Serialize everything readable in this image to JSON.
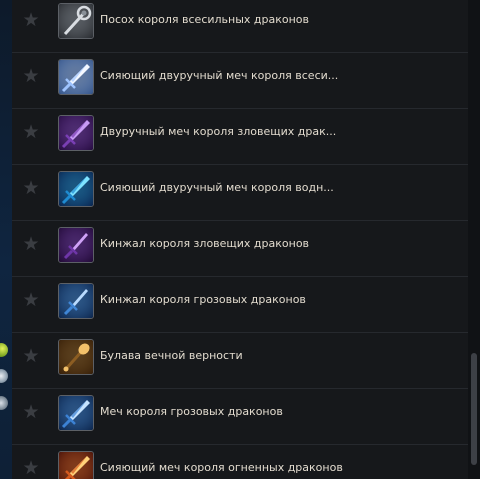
{
  "items": [
    {
      "name": "Посох короля всесильных драконов",
      "icon": "staff-icon",
      "colors": [
        "#d9dde2",
        "#8a9199",
        "#2c2f34"
      ]
    },
    {
      "name": "Сияющий двуручный меч короля всеси...",
      "icon": "sword-icon",
      "colors": [
        "#f4f8ff",
        "#9fc4ff",
        "#3a5a8f"
      ]
    },
    {
      "name": "Двуручный меч короля зловещих драк...",
      "icon": "sword-icon",
      "colors": [
        "#c89cf5",
        "#7a3fb4",
        "#2a0f45"
      ]
    },
    {
      "name": "Сияющий двуручный меч короля водн...",
      "icon": "sword-icon",
      "colors": [
        "#7fe3ff",
        "#1f8bd1",
        "#0b2a55"
      ]
    },
    {
      "name": "Кинжал короля зловещих драконов",
      "icon": "dagger-icon",
      "colors": [
        "#cfa2f7",
        "#6f36a8",
        "#240c3a"
      ]
    },
    {
      "name": "Кинжал короля грозовых драконов",
      "icon": "dagger-icon",
      "colors": [
        "#b9dbff",
        "#3f86d6",
        "#0f2a52"
      ]
    },
    {
      "name": "Булава вечной верности",
      "icon": "mace-icon",
      "colors": [
        "#f2c06a",
        "#8c5d22",
        "#3a220a"
      ]
    },
    {
      "name": "Меч короля грозовых драконов",
      "icon": "sword-icon",
      "colors": [
        "#c6e4ff",
        "#3c82d4",
        "#0f2a52"
      ]
    },
    {
      "name": "Сияющий меч короля огненных драконов",
      "icon": "sword-icon",
      "colors": [
        "#ffd27a",
        "#d55a1e",
        "#4a140a"
      ]
    }
  ],
  "favorite_icon": "star-icon",
  "theme": {
    "background": "#16181b",
    "divider": "#26292e",
    "text": "#e3dccf",
    "star": "#3a3d42"
  }
}
